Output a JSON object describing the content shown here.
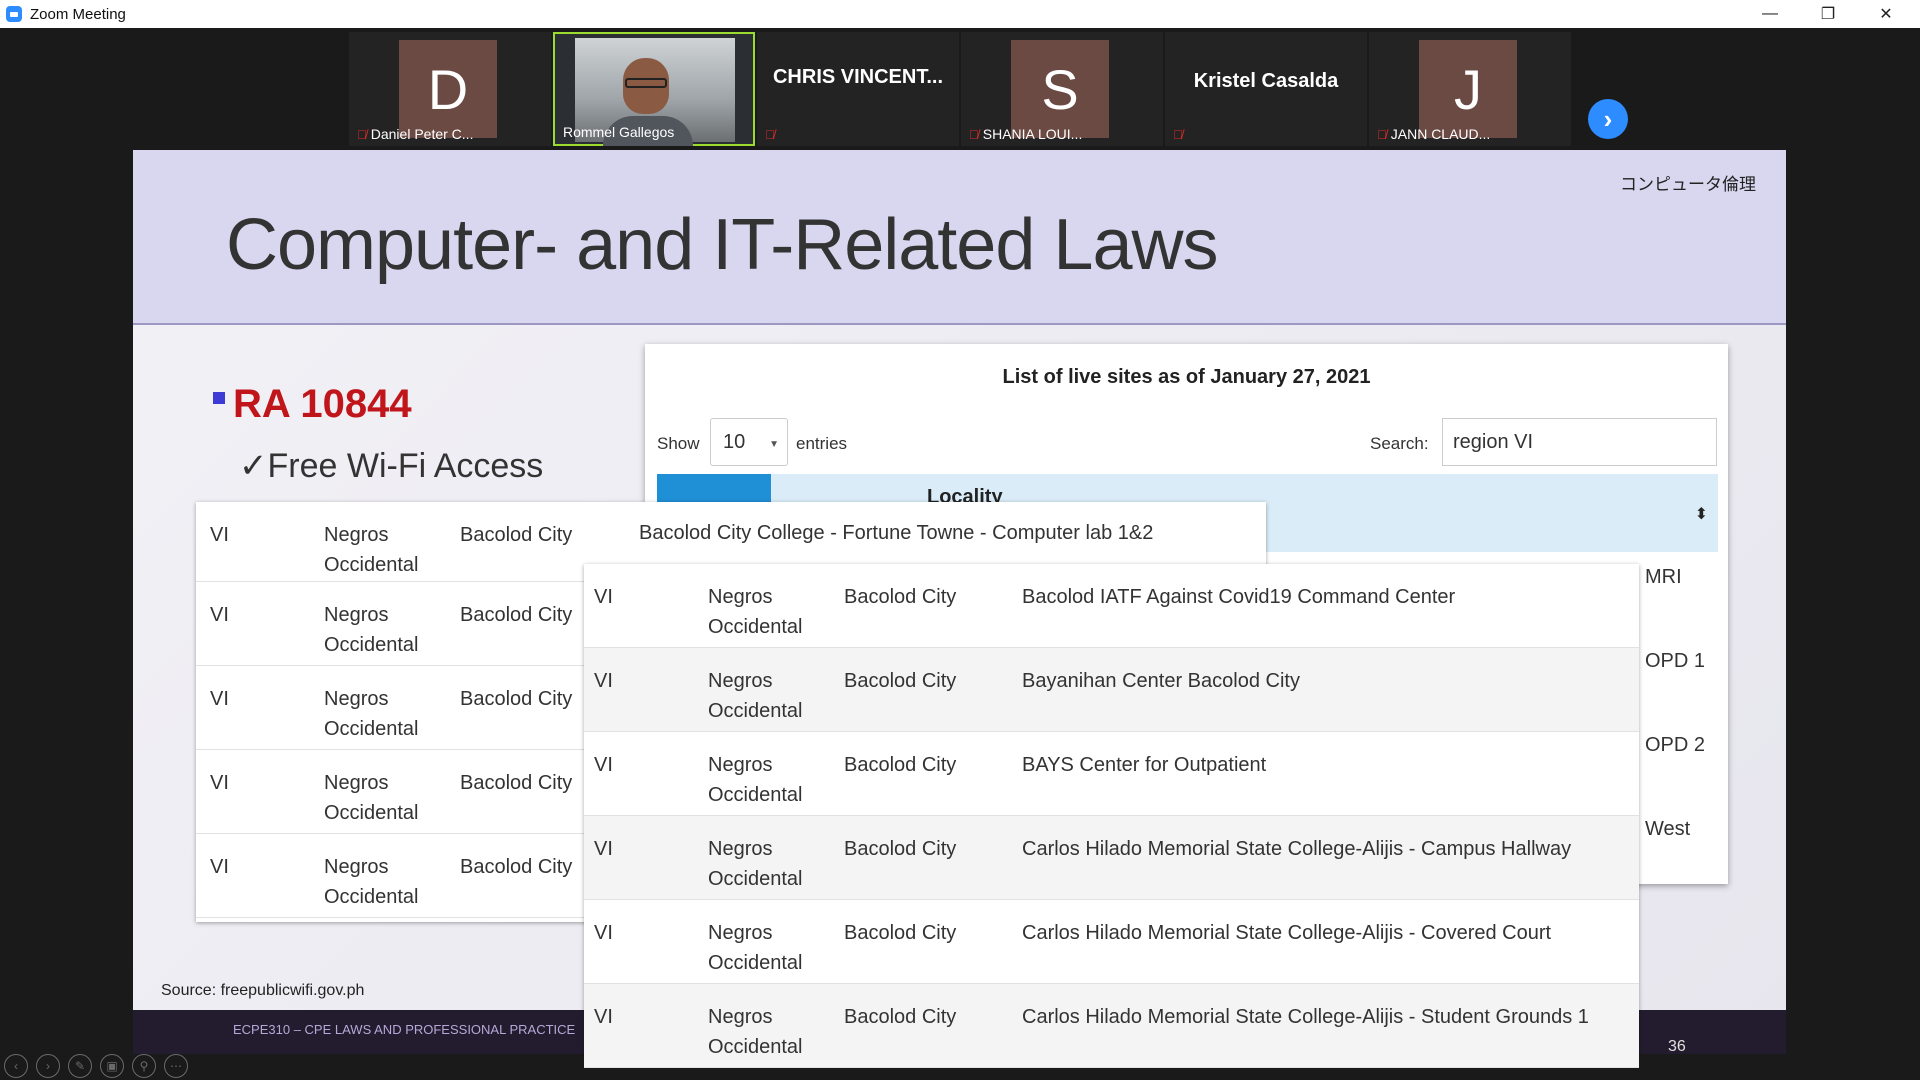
{
  "window": {
    "title": "Zoom Meeting"
  },
  "participants": [
    {
      "initial": "D",
      "name": "Daniel Peter C..."
    },
    {
      "initial": "",
      "name": "Rommel Gallegos"
    },
    {
      "initial": "",
      "name": "CHRIS  VINCENT..."
    },
    {
      "initial": "S",
      "name": "SHANIA LOUI..."
    },
    {
      "initial": "",
      "name": "Kristel Casalda"
    },
    {
      "initial": "J",
      "name": "JANN CLAUD..."
    }
  ],
  "slide": {
    "header_jp": "コンピュータ倫理",
    "title": "Computer- and IT-Related Laws",
    "law": "RA 10844",
    "check_item": "Free Wi-Fi Access",
    "source": "Source: freepublicwifi.gov.ph",
    "footer": "ECPE310 – CPE LAWS AND PROFESSIONAL PRACTICE",
    "page": "36"
  },
  "widget": {
    "title": "List of live sites as of January 27, 2021",
    "show_label": "Show",
    "entries_value": "10",
    "entries_label": "entries",
    "search_label": "Search:",
    "search_value": "region VI",
    "column_header": "Locality",
    "right_col": [
      "MRI",
      "OPD 1",
      "OPD 2",
      "West"
    ]
  },
  "table_back": [
    {
      "region": "VI",
      "province": "Negros Occidental",
      "city": "Bacolod City",
      "site": "Bacolod City College - Fortune Towne - Computer lab 1&2"
    },
    {
      "region": "VI",
      "province": "Negros Occidental",
      "city": "Bacolod City",
      "site": ""
    },
    {
      "region": "VI",
      "province": "Negros Occidental",
      "city": "Bacolod City",
      "site": ""
    },
    {
      "region": "VI",
      "province": "Negros Occidental",
      "city": "Bacolod City",
      "site": ""
    },
    {
      "region": "VI",
      "province": "Negros Occidental",
      "city": "Bacolod City",
      "site": ""
    }
  ],
  "table_front": [
    {
      "region": "VI",
      "province": "Negros Occidental",
      "city": "Bacolod City",
      "site": "Bacolod IATF Against Covid19 Command Center"
    },
    {
      "region": "VI",
      "province": "Negros Occidental",
      "city": "Bacolod City",
      "site": "Bayanihan Center Bacolod City"
    },
    {
      "region": "VI",
      "province": "Negros Occidental",
      "city": "Bacolod City",
      "site": "BAYS Center for Outpatient"
    },
    {
      "region": "VI",
      "province": "Negros Occidental",
      "city": "Bacolod City",
      "site": "Carlos Hilado Memorial State College-Alijis - Campus Hallway"
    },
    {
      "region": "VI",
      "province": "Negros Occidental",
      "city": "Bacolod City",
      "site": "Carlos Hilado Memorial State College-Alijis - Covered Court"
    },
    {
      "region": "VI",
      "province": "Negros Occidental",
      "city": "Bacolod City",
      "site": "Carlos Hilado Memorial State College-Alijis - Student Grounds 1"
    }
  ],
  "colors": {
    "zoom_blue": "#2d8cff",
    "slide_header": "#d9d6ef",
    "law_red": "#c0161b",
    "active_speaker": "#9bdc2f"
  }
}
